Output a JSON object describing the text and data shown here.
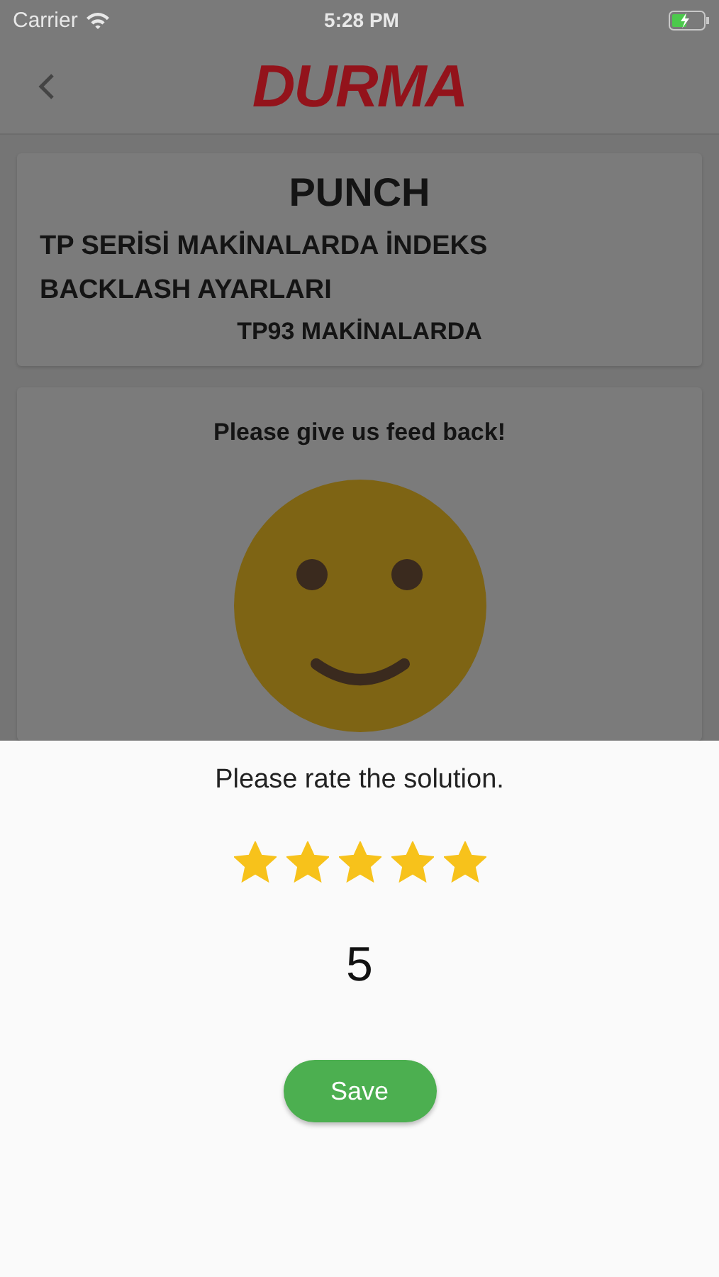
{
  "status_bar": {
    "carrier": "Carrier",
    "time": "5:28 PM",
    "charging": true
  },
  "nav": {
    "logo": "DURMA"
  },
  "document": {
    "category": "PUNCH",
    "title": "TP SERİSİ MAKİNALARDA İNDEKS BACKLASH AYARLARI",
    "subtitle": "TP93 MAKİNALARDA"
  },
  "feedback": {
    "heading": "Please give us feed back!"
  },
  "rating_sheet": {
    "prompt": "Please rate the solution.",
    "stars": 5,
    "value": "5",
    "save_button": "Save"
  }
}
